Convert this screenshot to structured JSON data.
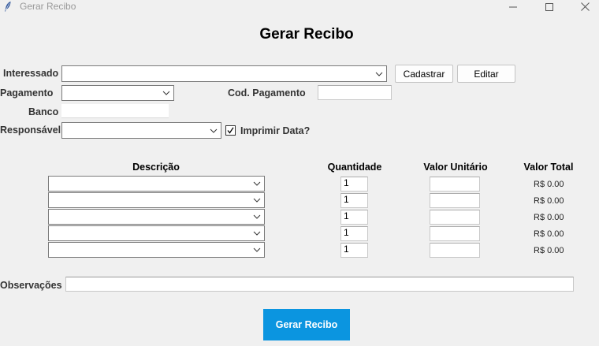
{
  "window": {
    "title": "Gerar Recibo",
    "app_icon": "feather-icon",
    "controls": [
      "minimize-icon",
      "maximize-icon",
      "close-icon"
    ]
  },
  "heading": "Gerar Recibo",
  "form": {
    "interessado_label": "Interessado",
    "interessado_value": "",
    "cadastrar_label": "Cadastrar",
    "editar_label": "Editar",
    "pagamento_label": "Pagamento",
    "pagamento_value": "",
    "cod_pagamento_label": "Cod. Pagamento",
    "cod_pagamento_value": "",
    "banco_label": "Banco",
    "banco_value": "",
    "responsavel_label": "Responsável",
    "responsavel_value": "",
    "imprimir_data_label": "Imprimir Data?",
    "imprimir_data_checked": true
  },
  "items": {
    "headers": {
      "descricao": "Descrição",
      "quantidade": "Quantidade",
      "valor_unitario": "Valor Unitário",
      "valor_total": "Valor Total"
    },
    "rows": [
      {
        "descricao": "",
        "quantidade": "1",
        "valor_unitario": "",
        "valor_total": "R$ 0.00"
      },
      {
        "descricao": "",
        "quantidade": "1",
        "valor_unitario": "",
        "valor_total": "R$ 0.00"
      },
      {
        "descricao": "",
        "quantidade": "1",
        "valor_unitario": "",
        "valor_total": "R$ 0.00"
      },
      {
        "descricao": "",
        "quantidade": "1",
        "valor_unitario": "",
        "valor_total": "R$ 0.00"
      },
      {
        "descricao": "",
        "quantidade": "1",
        "valor_unitario": "",
        "valor_total": "R$ 0.00"
      }
    ]
  },
  "observacoes": {
    "label": "Observações",
    "value": ""
  },
  "submit_label": "Gerar Recibo",
  "colors": {
    "primary_button": "#0b95e0",
    "background": "#f0f0f0"
  }
}
